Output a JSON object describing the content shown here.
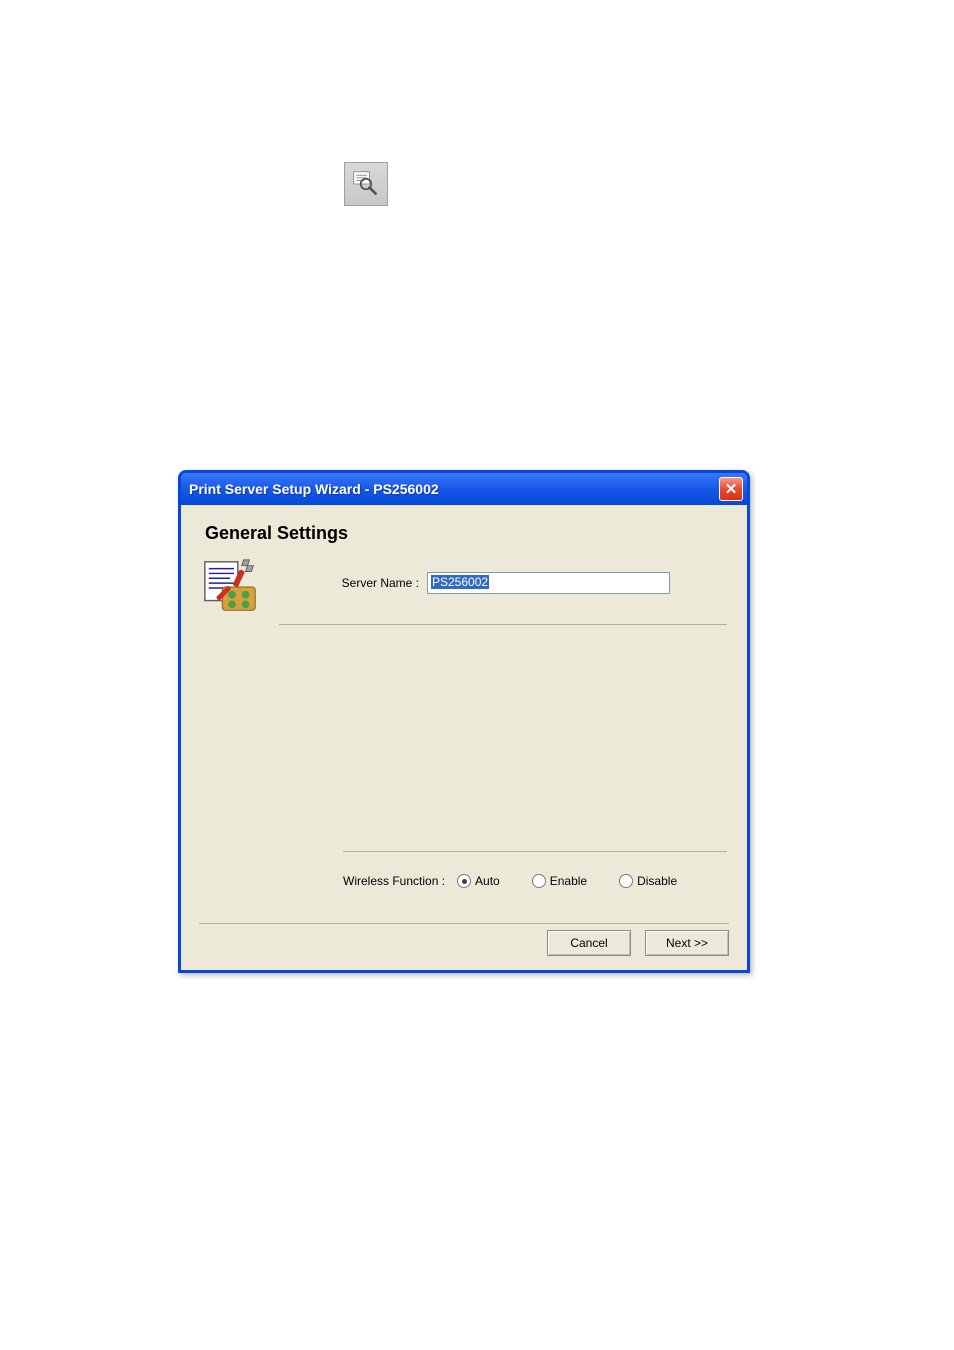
{
  "toolbar": {
    "wizard_icon_name": "wizard-magnify-icon"
  },
  "dialog": {
    "title": "Print Server Setup Wizard - PS256002",
    "close_label": "✕",
    "section_title": "General Settings",
    "server_name_label": "Server Name :",
    "server_name_value": "PS256002",
    "wireless_label": "Wireless Function :",
    "wireless_options": {
      "auto": "Auto",
      "enable": "Enable",
      "disable": "Disable"
    },
    "wireless_selected": "auto",
    "buttons": {
      "cancel": "Cancel",
      "next": "Next >>"
    }
  }
}
